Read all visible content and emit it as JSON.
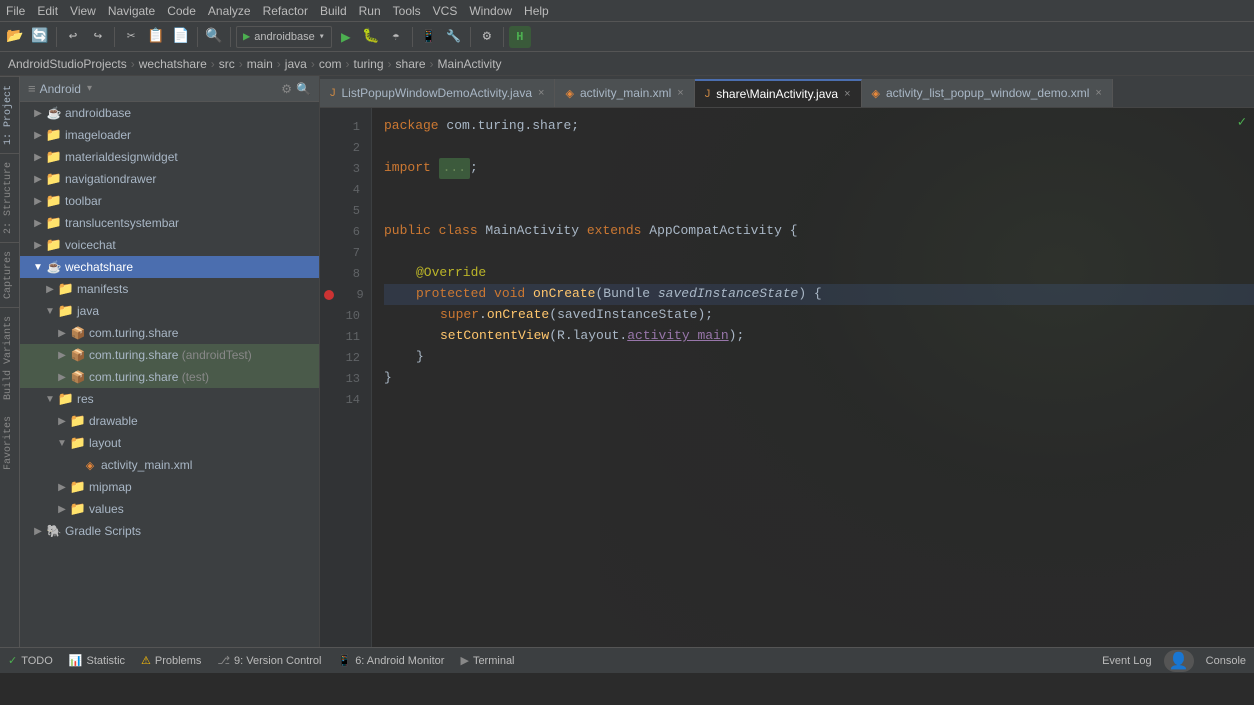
{
  "menubar": {
    "items": [
      "File",
      "Edit",
      "View",
      "Navigate",
      "Code",
      "Analyze",
      "Refactor",
      "Build",
      "Run",
      "Tools",
      "VCS",
      "Window",
      "Help"
    ]
  },
  "breadcrumb": {
    "items": [
      "AndroidStudioProjects",
      "wechatshare",
      "src",
      "main",
      "java",
      "com",
      "turing",
      "share",
      "MainActivity"
    ]
  },
  "tree": {
    "header": "Android",
    "items": [
      {
        "indent": 0,
        "type": "root",
        "label": "Android",
        "expanded": true
      },
      {
        "indent": 1,
        "type": "module",
        "label": "androidbase",
        "expanded": false
      },
      {
        "indent": 1,
        "type": "folder",
        "label": "imageloader",
        "expanded": false
      },
      {
        "indent": 1,
        "type": "folder",
        "label": "materialdesignwidget",
        "expanded": false
      },
      {
        "indent": 1,
        "type": "folder",
        "label": "navigationdrawer",
        "expanded": false
      },
      {
        "indent": 1,
        "type": "folder",
        "label": "toolbar",
        "expanded": false
      },
      {
        "indent": 1,
        "type": "folder",
        "label": "translucentsystembar",
        "expanded": false
      },
      {
        "indent": 1,
        "type": "folder",
        "label": "voicechat",
        "expanded": false
      },
      {
        "indent": 1,
        "type": "module",
        "label": "wechatshare",
        "expanded": true,
        "selected": true
      },
      {
        "indent": 2,
        "type": "folder",
        "label": "manifests",
        "expanded": false
      },
      {
        "indent": 2,
        "type": "folder",
        "label": "java",
        "expanded": true
      },
      {
        "indent": 3,
        "type": "package",
        "label": "com.turing.share",
        "expanded": false
      },
      {
        "indent": 3,
        "type": "package_android",
        "label": "com.turing.share (androidTest)",
        "expanded": false,
        "highlighted": true
      },
      {
        "indent": 3,
        "type": "package_test",
        "label": "com.turing.share (test)",
        "expanded": false,
        "highlighted": true
      },
      {
        "indent": 2,
        "type": "folder",
        "label": "res",
        "expanded": true
      },
      {
        "indent": 3,
        "type": "folder",
        "label": "drawable",
        "expanded": false
      },
      {
        "indent": 3,
        "type": "folder",
        "label": "layout",
        "expanded": true
      },
      {
        "indent": 4,
        "type": "file_xml",
        "label": "activity_main.xml"
      },
      {
        "indent": 3,
        "type": "folder",
        "label": "mipmap",
        "expanded": false
      },
      {
        "indent": 3,
        "type": "folder",
        "label": "values",
        "expanded": false
      },
      {
        "indent": 1,
        "type": "gradle",
        "label": "Gradle Scripts",
        "expanded": false
      }
    ]
  },
  "tabs": [
    {
      "label": "ListPopupWindowDemoActivity.java",
      "active": false,
      "icon": "java"
    },
    {
      "label": "activity_main.xml",
      "active": false,
      "icon": "xml"
    },
    {
      "label": "share\\MainActivity.java",
      "active": true,
      "icon": "java"
    },
    {
      "label": "activity_list_popup_window_demo.xml",
      "active": false,
      "icon": "xml"
    }
  ],
  "code": {
    "lines": [
      {
        "num": 1,
        "content": "package com.turing.share;",
        "type": "code"
      },
      {
        "num": 2,
        "content": "",
        "type": "empty"
      },
      {
        "num": 3,
        "content": "import ...;",
        "type": "import"
      },
      {
        "num": 4,
        "content": "",
        "type": "empty"
      },
      {
        "num": 5,
        "content": "",
        "type": "empty"
      },
      {
        "num": 6,
        "content": "public class MainActivity extends AppCompatActivity {",
        "type": "class"
      },
      {
        "num": 7,
        "content": "",
        "type": "empty"
      },
      {
        "num": 8,
        "content": "    @Override",
        "type": "annotation"
      },
      {
        "num": 9,
        "content": "    protected void onCreate(Bundle savedInstanceState) {",
        "type": "method",
        "marker": "breakpoint"
      },
      {
        "num": 10,
        "content": "        super.onCreate(savedInstanceState);",
        "type": "body"
      },
      {
        "num": 11,
        "content": "        setContentView(R.layout.activity_main);",
        "type": "body"
      },
      {
        "num": 12,
        "content": "    }",
        "type": "closing"
      },
      {
        "num": 13,
        "content": "}",
        "type": "closing"
      },
      {
        "num": 14,
        "content": "",
        "type": "empty"
      }
    ]
  },
  "statusbar": {
    "items": [
      {
        "icon": "todo",
        "label": "TODO"
      },
      {
        "icon": "statistic",
        "label": "Statistic"
      },
      {
        "icon": "problems",
        "label": "Problems"
      },
      {
        "icon": "vcs",
        "label": "9: Version Control"
      },
      {
        "icon": "monitor",
        "label": "6: Android Monitor"
      },
      {
        "icon": "terminal",
        "label": "Terminal"
      }
    ],
    "right": {
      "event_log": "Event Log",
      "console": "Console"
    }
  },
  "side_panels": {
    "left": [
      "1: Project",
      "2: Structure",
      "Captures",
      "Build Variants",
      "Favorites"
    ],
    "right": []
  }
}
